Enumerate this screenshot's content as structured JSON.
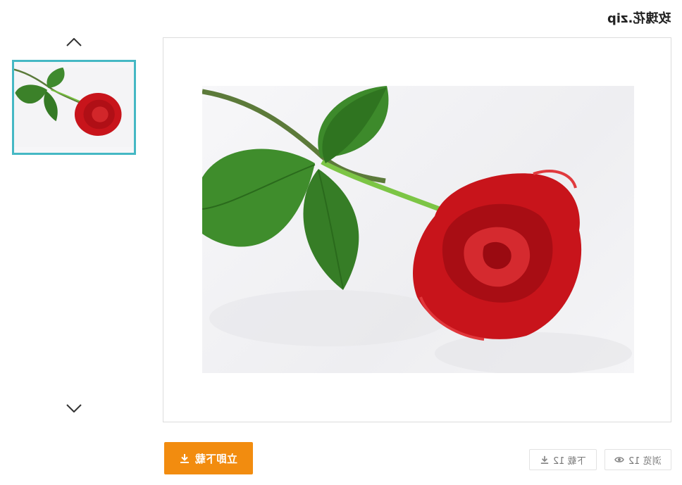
{
  "page": {
    "title": "玫瑰花.zip"
  },
  "gallery": {
    "nav_up_icon": "chevron-up-icon",
    "nav_down_icon": "chevron-down-icon",
    "thumbnail_border_color": "#45b8c4"
  },
  "actions": {
    "download_label": "立即下载",
    "download_icon": "download-icon",
    "download_color": "#f28c0f"
  },
  "stats": {
    "downloads_label": "下载 12",
    "downloads_icon": "download-icon",
    "views_label": "浏览 12",
    "views_icon": "eye-icon"
  }
}
